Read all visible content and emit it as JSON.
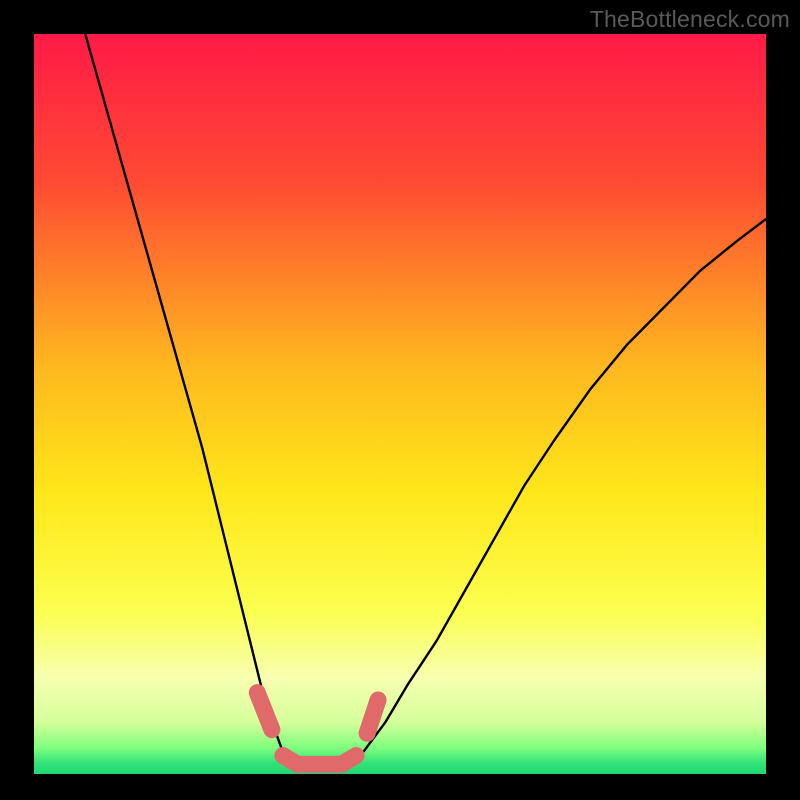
{
  "watermark": "TheBottleneck.com",
  "chart_data": {
    "type": "line",
    "title": "",
    "xlabel": "",
    "ylabel": "",
    "xlim": [
      0,
      100
    ],
    "ylim": [
      0,
      100
    ],
    "grid": false,
    "legend": "none",
    "annotations": [],
    "gradient_stops": [
      {
        "pos": 0.0,
        "color": "#ff1a47"
      },
      {
        "pos": 0.2,
        "color": "#ff4a33"
      },
      {
        "pos": 0.45,
        "color": "#ffb81f"
      },
      {
        "pos": 0.62,
        "color": "#ffe71a"
      },
      {
        "pos": 0.78,
        "color": "#fbff4f"
      },
      {
        "pos": 0.87,
        "color": "#f7ffb0"
      },
      {
        "pos": 0.93,
        "color": "#d5ff9a"
      },
      {
        "pos": 0.965,
        "color": "#7dff7d"
      },
      {
        "pos": 0.985,
        "color": "#34e27a"
      },
      {
        "pos": 1.0,
        "color": "#1fd86f"
      }
    ],
    "series": [
      {
        "name": "curve-left",
        "stroke": "#000000",
        "stroke_width": 2.4,
        "x": [
          7,
          9,
          11,
          13,
          15,
          17,
          19,
          21,
          23,
          25,
          26.5,
          28,
          29.5,
          31,
          32.5,
          34
        ],
        "y": [
          100,
          93,
          86,
          79,
          72,
          65,
          58,
          51,
          44,
          36,
          30,
          24,
          18,
          12,
          7,
          3
        ]
      },
      {
        "name": "curve-right",
        "stroke": "#000000",
        "stroke_width": 2.4,
        "x": [
          45,
          48,
          51,
          55,
          59,
          63,
          67,
          71,
          76,
          81,
          86,
          91,
          96,
          100
        ],
        "y": [
          3,
          7,
          12,
          18,
          25,
          32,
          39,
          45,
          52,
          58,
          63,
          68,
          72,
          75
        ]
      },
      {
        "name": "highlight-band",
        "stroke": "#e06a6a",
        "stroke_width": 17,
        "linecap": "round",
        "x": [
          30.5,
          32.5,
          34,
          36,
          38,
          40,
          42,
          44,
          45.5,
          47
        ],
        "y": [
          11,
          6,
          2.5,
          1.3,
          1.3,
          1.3,
          1.3,
          2.5,
          5.5,
          10
        ],
        "gaps_after_index": [
          1,
          7
        ]
      }
    ]
  }
}
